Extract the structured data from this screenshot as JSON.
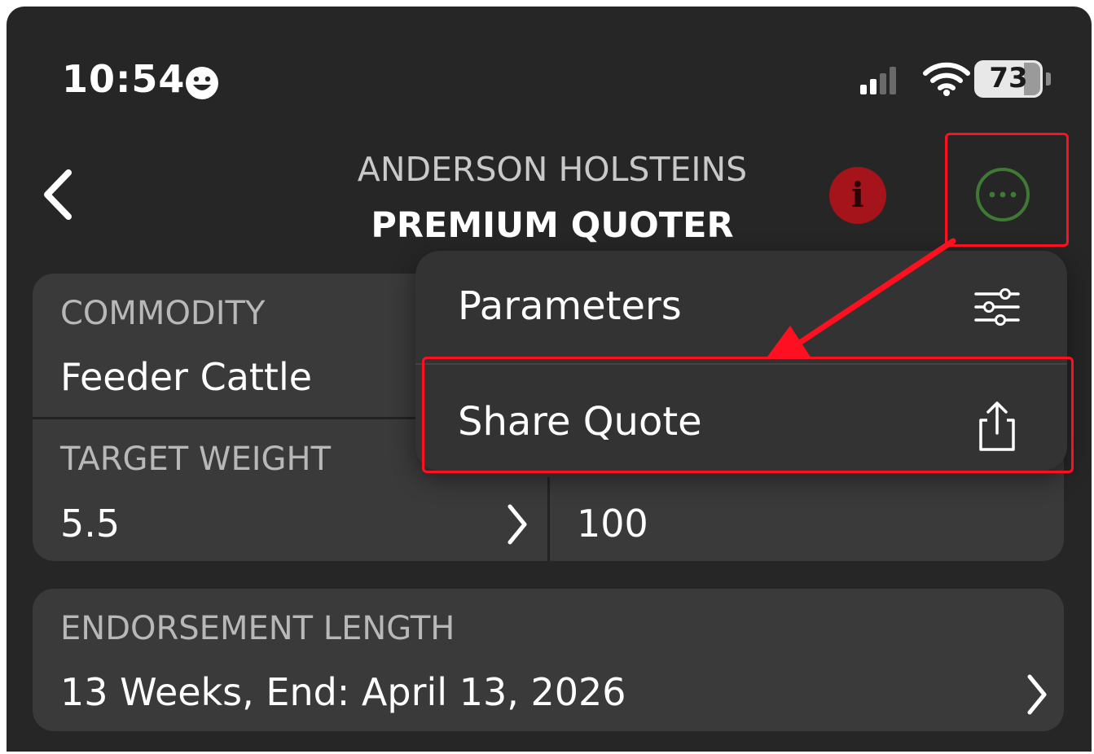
{
  "status_bar": {
    "time": "10:54",
    "battery": "73"
  },
  "header": {
    "subtitle": "ANDERSON HOLSTEINS",
    "title": "PREMIUM QUOTER",
    "info_badge": "i"
  },
  "fields": {
    "commodity": {
      "label": "COMMODITY",
      "value": "Feeder Cattle"
    },
    "target_weight": {
      "label": "TARGET WEIGHT",
      "value": "5.5"
    },
    "second_value": {
      "value": "100"
    },
    "endorsement_length": {
      "label": "ENDORSEMENT LENGTH",
      "value": "13 Weeks, End: April 13, 2026"
    }
  },
  "menu": {
    "items": [
      {
        "label": "Parameters",
        "icon": "sliders-icon"
      },
      {
        "label": "Share Quote",
        "icon": "share-icon"
      }
    ]
  },
  "colors": {
    "background": "#262626",
    "card": "#3a3a3a",
    "menu": "#333333",
    "highlight": "#ff1020",
    "info_badge": "#a5141a",
    "more_ring": "#3f7a35"
  }
}
